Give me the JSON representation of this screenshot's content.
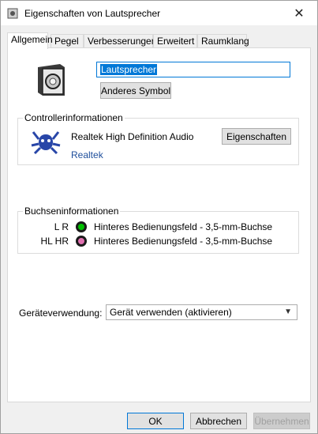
{
  "window": {
    "title": "Eigenschaften von Lautsprecher",
    "close_glyph": "✕"
  },
  "tabs": [
    "Allgemein",
    "Pegel",
    "Verbesserungen",
    "Erweitert",
    "Raumklang"
  ],
  "general": {
    "device_name": "Lautsprecher",
    "change_icon_label": "Anderes Symbol"
  },
  "controller": {
    "group_label": "Controllerinformationen",
    "name": "Realtek High Definition Audio",
    "properties_label": "Eigenschaften",
    "vendor_link": "Realtek"
  },
  "jacks": {
    "group_label": "Buchseninformationen",
    "items": [
      {
        "channels": "L R",
        "jack_color": "#00c000",
        "description": "Hinteres Bedienungsfeld - 3,5-mm-Buchse"
      },
      {
        "channels": "HL HR",
        "jack_color": "#e070b0",
        "description": "Hinteres Bedienungsfeld - 3,5-mm-Buchse"
      }
    ]
  },
  "usage": {
    "label": "Geräteverwendung:",
    "selected": "Gerät verwenden (aktivieren)"
  },
  "buttons": {
    "ok": "OK",
    "cancel": "Abbrechen",
    "apply": "Übernehmen"
  }
}
